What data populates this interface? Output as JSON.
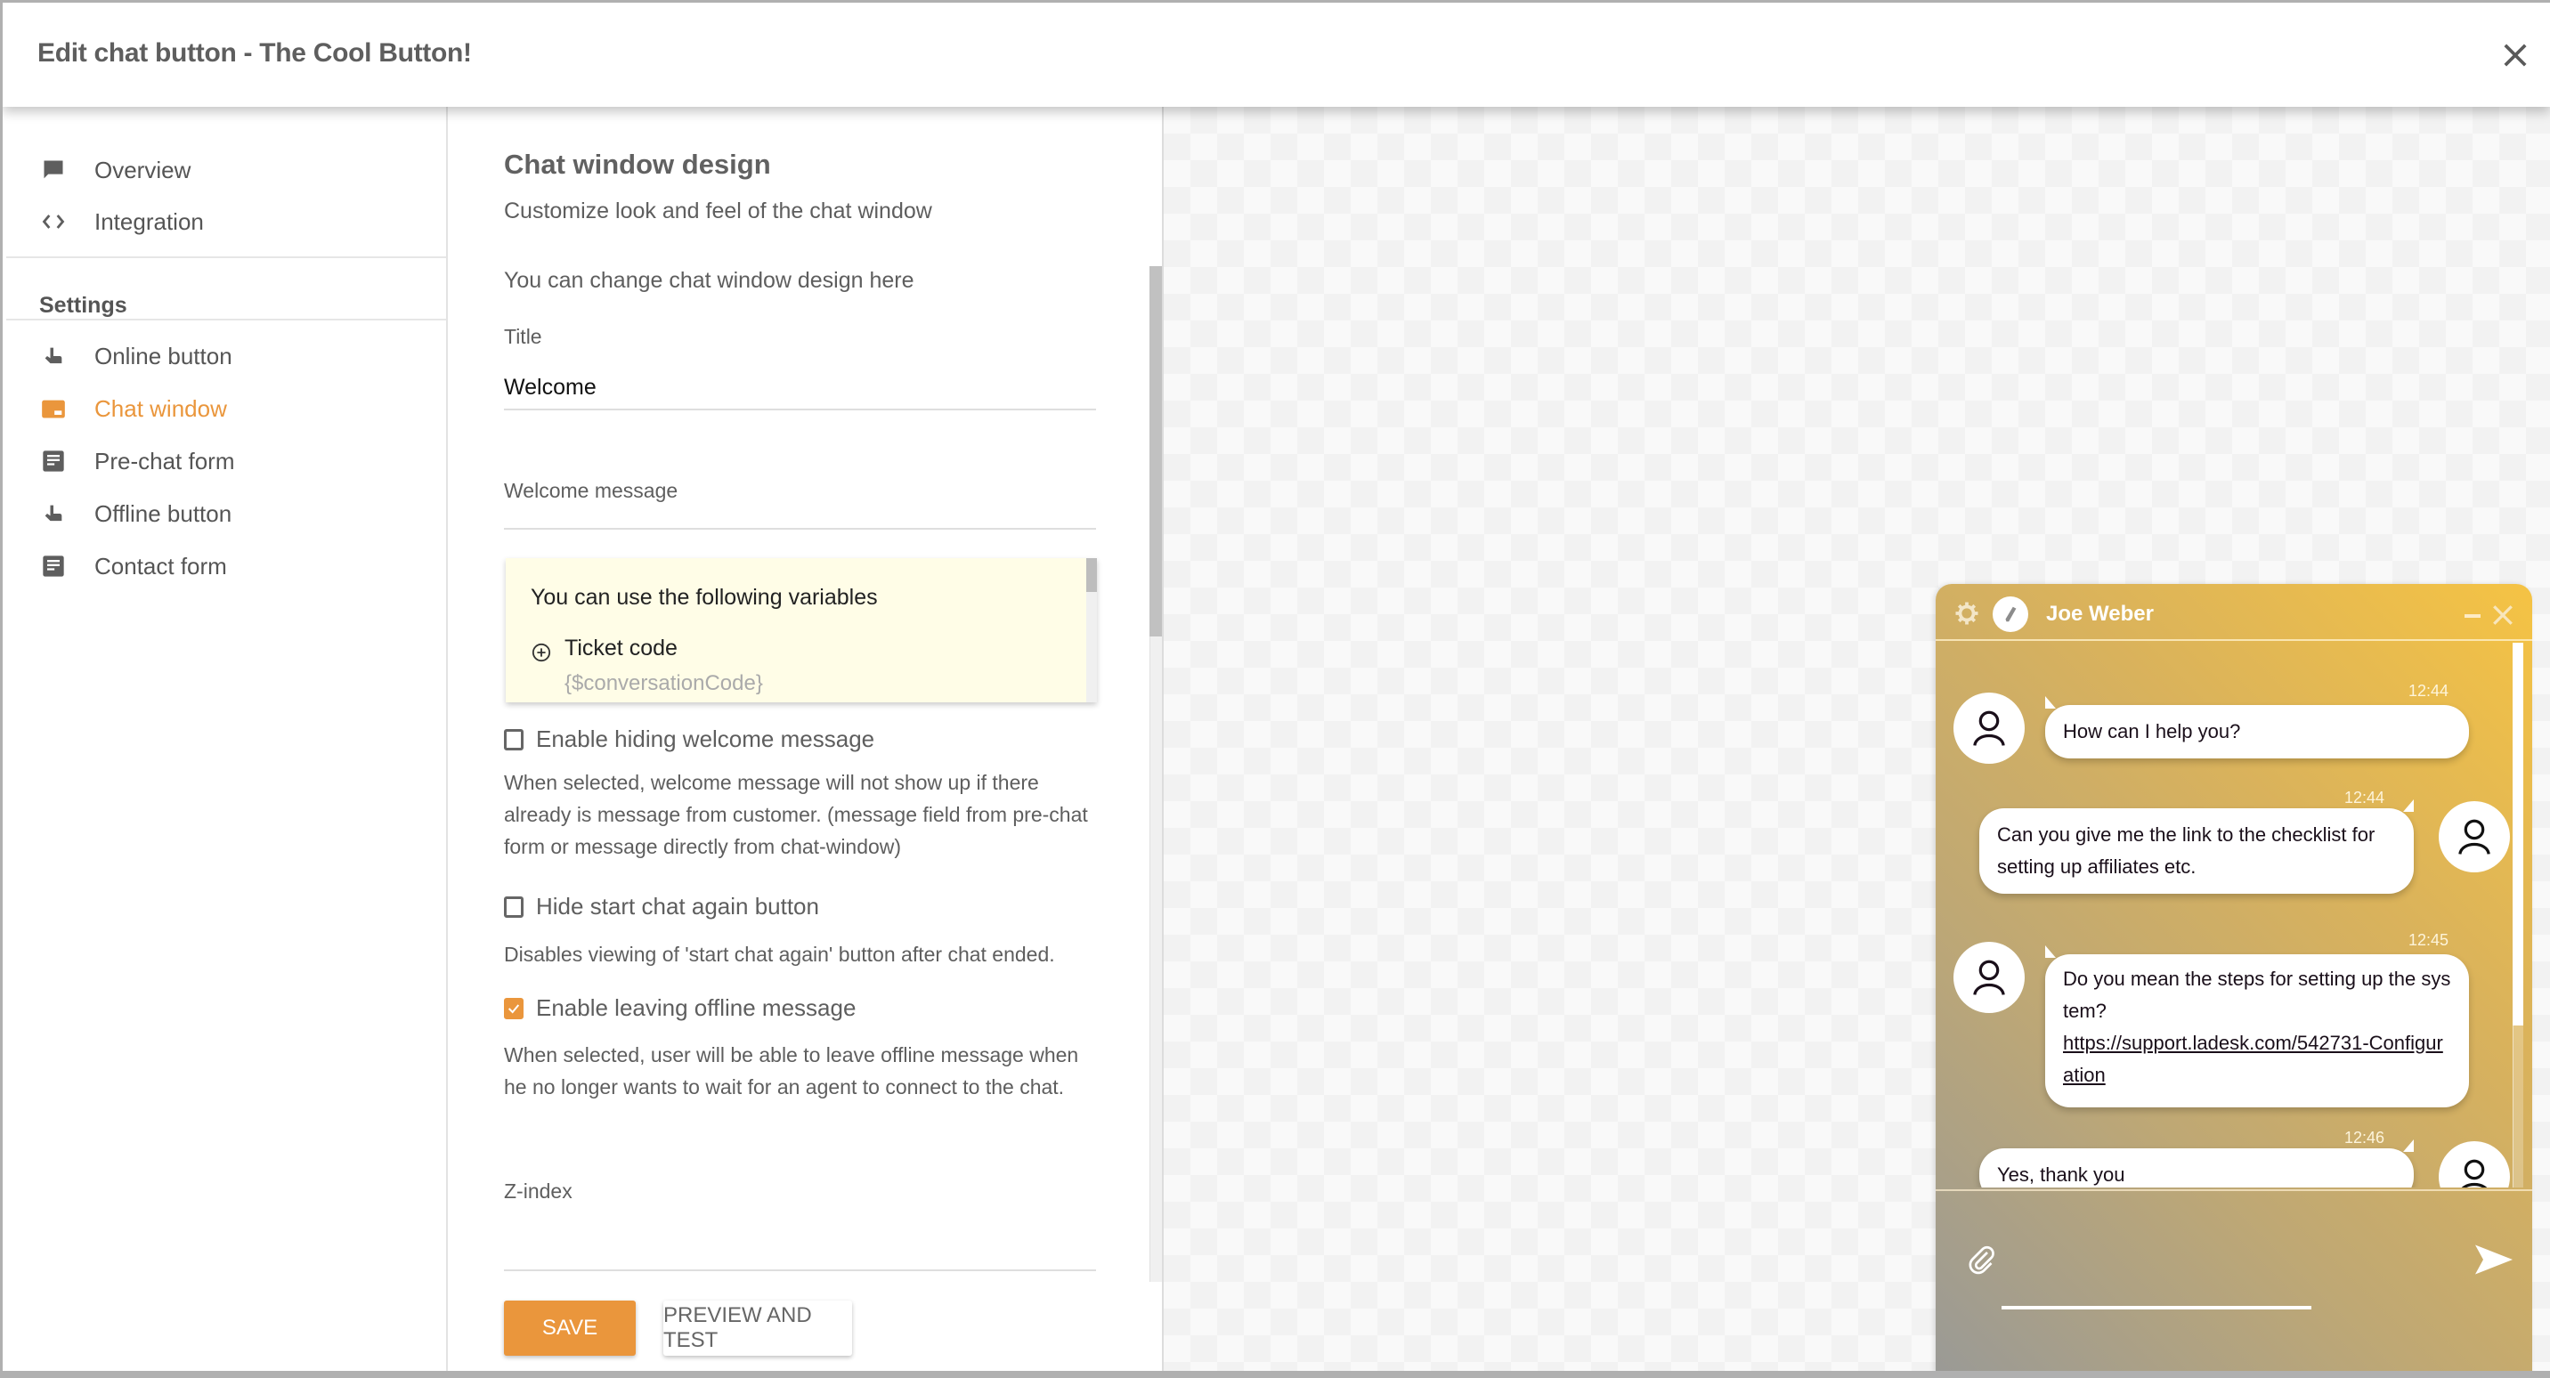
{
  "header": {
    "title": "Edit chat button - The Cool Button!",
    "close_icon": "close-icon"
  },
  "sidebar": {
    "top_items": [
      {
        "label": "Overview",
        "icon": "chat-bubble-icon"
      },
      {
        "label": "Integration",
        "icon": "code-icon"
      }
    ],
    "settings_heading": "Settings",
    "settings_items": [
      {
        "label": "Online button",
        "icon": "pointer-hand-icon",
        "active": false
      },
      {
        "label": "Chat window",
        "icon": "chat-window-icon",
        "active": true
      },
      {
        "label": "Pre-chat form",
        "icon": "form-icon",
        "active": false
      },
      {
        "label": "Offline button",
        "icon": "pointer-hand-icon",
        "active": false
      },
      {
        "label": "Contact form",
        "icon": "form-icon",
        "active": false
      }
    ],
    "accent_color": "#ea963c"
  },
  "content": {
    "title": "Chat window design",
    "subtitle": "Customize look and feel of the chat window",
    "intro": "You can change chat window design here",
    "title_field": {
      "label": "Title",
      "value": "Welcome"
    },
    "welcome_field": {
      "label": "Welcome message",
      "value": ""
    },
    "variables": {
      "heading": "You can use the following variables",
      "items": [
        {
          "label": "Ticket code",
          "code": "{$conversationCode}"
        }
      ]
    },
    "options": [
      {
        "label": "Enable hiding welcome message",
        "checked": false,
        "description": "When selected, welcome message will not show up if there already is message from customer. (message field from pre-chat form or message directly from chat-window)"
      },
      {
        "label": "Hide start chat again button",
        "checked": false,
        "description": "Disables viewing of 'start chat again' button after chat ended."
      },
      {
        "label": "Enable leaving offline message",
        "checked": true,
        "description": "When selected, user will be able to leave offline message when he no longer wants to wait for an agent to connect to the chat."
      }
    ],
    "zindex_field": {
      "label": "Z-index",
      "value": ""
    },
    "save_label": "SAVE",
    "preview_label": "PREVIEW AND TEST"
  },
  "chat_preview": {
    "agent_name": "Joe Weber",
    "messages": [
      {
        "side": "left",
        "time": "12:44",
        "text": "How can I help you?"
      },
      {
        "side": "right",
        "time": "12:44",
        "text": "Can you give me the link to the checklist for setting up affiliates etc."
      },
      {
        "side": "left",
        "time": "12:45",
        "text": "Do you mean the steps for setting up the system?",
        "link": "https://support.ladesk.com/542731-Configuration"
      },
      {
        "side": "right",
        "time": "12:46",
        "text": "Yes, thank you"
      }
    ],
    "gradient_colors": [
      "#f5c344",
      "#9a9a96"
    ]
  }
}
